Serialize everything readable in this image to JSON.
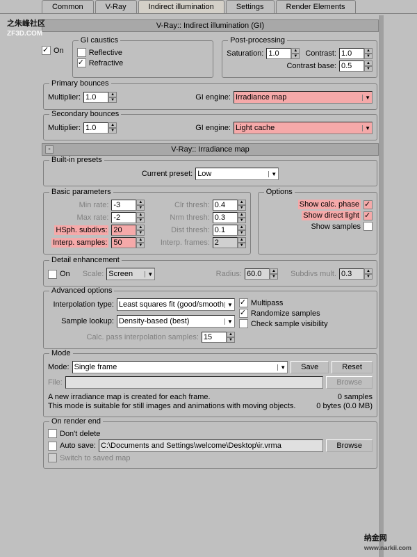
{
  "tabs": [
    "Common",
    "V-Ray",
    "Indirect illumination",
    "Settings",
    "Render Elements"
  ],
  "rollout1": {
    "title": "V-Ray:: Indirect illumination (GI)"
  },
  "gi": {
    "on": "On",
    "caustics": {
      "legend": "GI caustics",
      "reflective": "Reflective",
      "refractive": "Refractive"
    },
    "post": {
      "legend": "Post-processing",
      "sat_l": "Saturation:",
      "sat_v": "1.0",
      "con_l": "Contrast:",
      "con_v": "1.0",
      "cb_l": "Contrast base:",
      "cb_v": "0.5"
    },
    "prim": {
      "legend": "Primary bounces",
      "mult_l": "Multiplier:",
      "mult_v": "1.0",
      "eng_l": "GI engine:",
      "eng_v": "Irradiance map"
    },
    "sec": {
      "legend": "Secondary bounces",
      "mult_l": "Multiplier:",
      "mult_v": "1.0",
      "eng_l": "GI engine:",
      "eng_v": "Light cache"
    }
  },
  "rollout2": {
    "title": "V-Ray:: Irradiance map",
    "toggle": "-"
  },
  "preset": {
    "legend": "Built-in presets",
    "cur_l": "Current preset:",
    "cur_v": "Low"
  },
  "basic": {
    "legend": "Basic parameters",
    "minr_l": "Min rate:",
    "minr_v": "-3",
    "maxr_l": "Max rate:",
    "maxr_v": "-2",
    "hsph_l": "HSph. subdivs:",
    "hsph_v": "20",
    "isamp_l": "Interp. samples:",
    "isamp_v": "50",
    "clr_l": "Clr thresh:",
    "clr_v": "0.4",
    "nrm_l": "Nrm thresh:",
    "nrm_v": "0.3",
    "dist_l": "Dist thresh:",
    "dist_v": "0.1",
    "ifrm_l": "Interp. frames:",
    "ifrm_v": "2"
  },
  "opt": {
    "legend": "Options",
    "scp": "Show calc. phase",
    "sdl": "Show direct light",
    "ss": "Show samples"
  },
  "det": {
    "legend": "Detail enhancement",
    "on": "On",
    "scale_l": "Scale:",
    "scale_v": "Screen",
    "rad_l": "Radius:",
    "rad_v": "60.0",
    "sdm_l": "Subdivs mult.",
    "sdm_v": "0.3"
  },
  "adv": {
    "legend": "Advanced options",
    "itype_l": "Interpolation type:",
    "itype_v": "Least squares fit (good/smooth",
    "slook_l": "Sample lookup:",
    "slook_v": "Density-based (best)",
    "cpis_l": "Calc. pass interpolation samples:",
    "cpis_v": "15",
    "mp": "Multipass",
    "rs": "Randomize samples",
    "csv": "Check sample visibility"
  },
  "mode": {
    "legend": "Mode",
    "mode_l": "Mode:",
    "mode_v": "Single frame",
    "save": "Save",
    "reset": "Reset",
    "file_l": "File:",
    "file_v": "",
    "browse": "Browse",
    "info1": "A new irradiance map is created for each frame.",
    "info2": "This mode is suitable for still images and animations with moving objects.",
    "stat1": "0 samples",
    "stat2": "0 bytes (0.0 MB)"
  },
  "ore": {
    "legend": "On render end",
    "dd": "Don't delete",
    "as": "Auto save:",
    "as_v": "C:\\Documents and Settings\\welcome\\Desktop\\ir.vrma",
    "browse": "Browse",
    "ssm": "Switch to saved map"
  },
  "wm1": {
    "t": "朱峰社区",
    "s": "ZF3D.COM"
  },
  "wm2": {
    "t": "纳金网",
    "s": "www.narkii.com"
  }
}
